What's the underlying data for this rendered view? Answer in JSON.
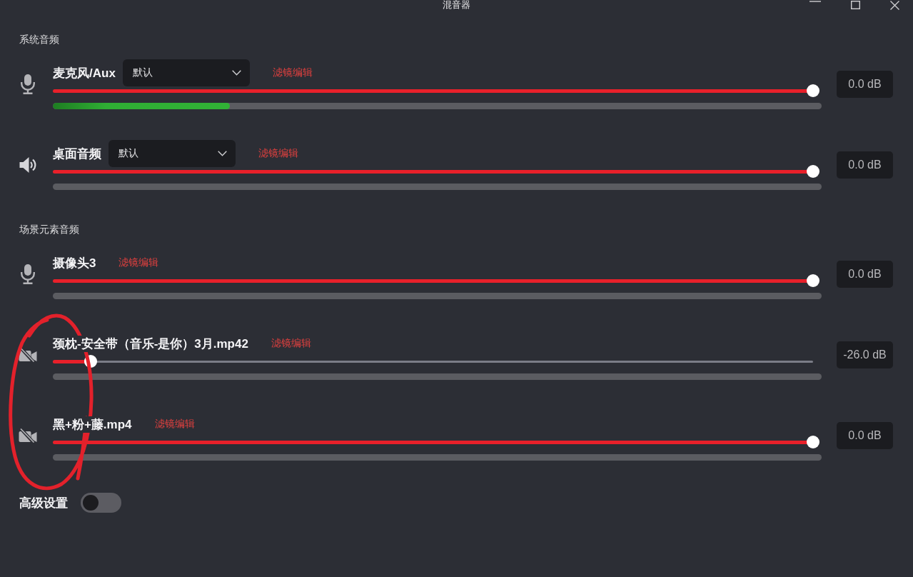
{
  "window": {
    "title": "混音器"
  },
  "sections": [
    {
      "title": "系统音频",
      "channels": [
        {
          "kind": "microphone",
          "name": "麦克风/Aux",
          "device": "默认",
          "filter_link": "滤镜编辑",
          "volume": {
            "level": 1
          },
          "meter": {
            "level": 0.23
          },
          "reading": "0.0 dB"
        },
        {
          "kind": "speaker",
          "name": "桌面音频",
          "device": "默认",
          "filter_link": "滤镜编辑",
          "volume": {
            "level": 1
          },
          "meter": {
            "level": 0
          },
          "reading": "0.0 dB"
        }
      ]
    },
    {
      "title": "场景元素音频",
      "channels": [
        {
          "kind": "microphone",
          "name": "摄像头3",
          "filter_link": "滤镜编辑",
          "volume": {
            "level": 1
          },
          "meter": {
            "level": 0
          },
          "reading": "0.0 dB"
        },
        {
          "kind": "video",
          "name": "颈枕-安全带（音乐-是你）3月.mp42",
          "filter_link": "滤镜编辑",
          "volume": {
            "level": 0.05
          },
          "meter": {
            "level": 0
          },
          "reading": "-26.0 dB"
        },
        {
          "kind": "video",
          "name": "黑+粉+藤.mp4",
          "filter_link": "滤镜编辑",
          "volume": {
            "level": 1
          },
          "meter": {
            "level": 0
          },
          "reading": "0.0 dB"
        }
      ]
    }
  ],
  "advanced_settings": {
    "label": "高级设置",
    "on": false
  }
}
